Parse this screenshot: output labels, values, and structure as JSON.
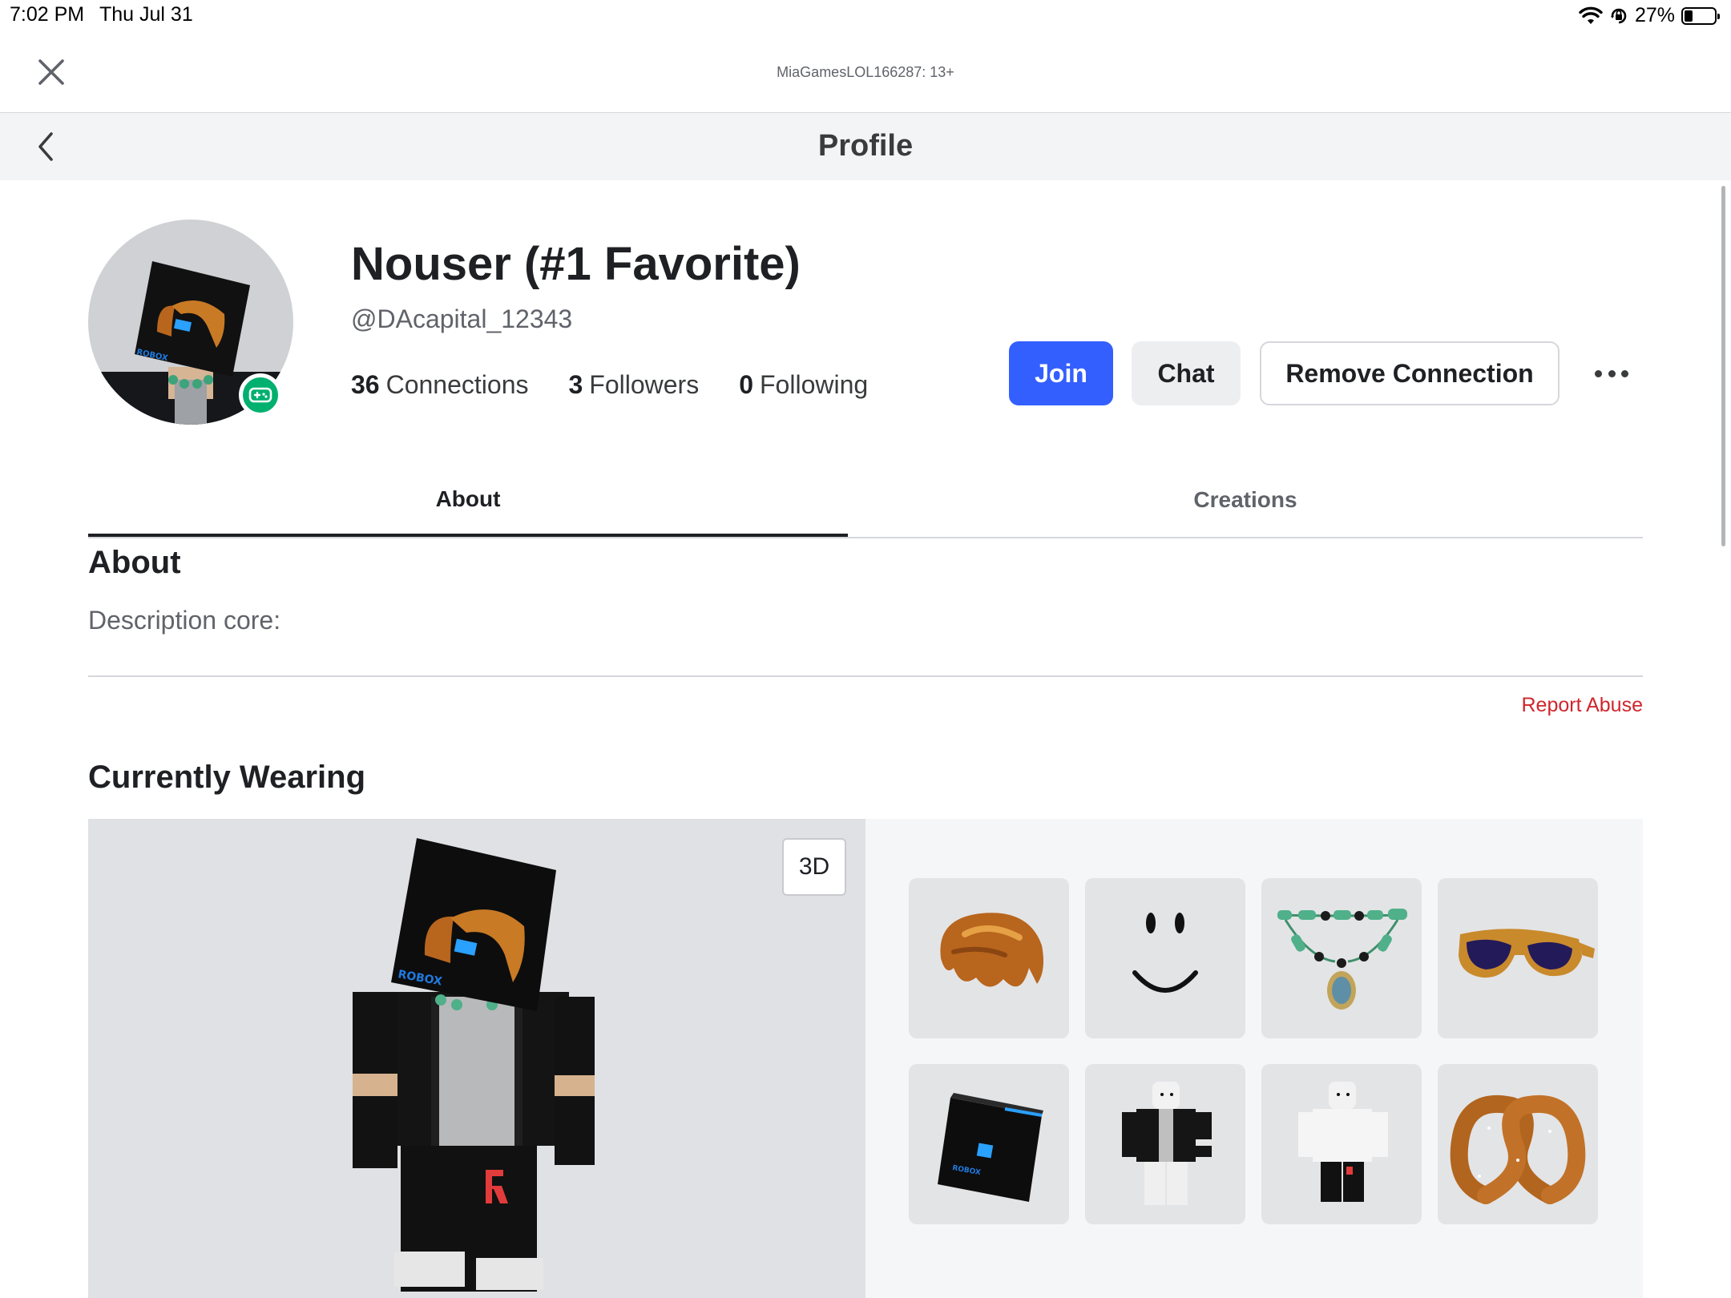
{
  "status_bar": {
    "time": "7:02 PM",
    "date": "Thu Jul 31",
    "battery": "27%",
    "battery_level": 0.27
  },
  "account": {
    "label": "MiaGamesLOL166287: 13+"
  },
  "header": {
    "title": "Profile"
  },
  "profile": {
    "display_name": "Nouser (#1 Favorite)",
    "username": "@DAcapital_12343",
    "connections": {
      "count": "36",
      "label": "Connections"
    },
    "followers": {
      "count": "3",
      "label": "Followers"
    },
    "following": {
      "count": "0",
      "label": "Following"
    },
    "presence": "in-game"
  },
  "actions": {
    "join": "Join",
    "chat": "Chat",
    "remove": "Remove Connection"
  },
  "tabs": [
    {
      "label": "About",
      "active": true
    },
    {
      "label": "Creations",
      "active": false
    }
  ],
  "about": {
    "title": "About",
    "description": "Description core:",
    "report": "Report Abuse"
  },
  "wearing": {
    "title": "Currently Wearing",
    "view_toggle": "3D",
    "items": [
      {
        "icon": "brown-hair-icon"
      },
      {
        "icon": "smile-face-icon"
      },
      {
        "icon": "jade-necklace-icon"
      },
      {
        "icon": "sunglasses-icon"
      },
      {
        "icon": "roblox-box-head-icon"
      },
      {
        "icon": "jacket-shirt-icon"
      },
      {
        "icon": "pants-icon"
      },
      {
        "icon": "pretzel-icon"
      }
    ]
  },
  "colors": {
    "join": "#335fff",
    "report": "#d0262c",
    "presence": "#00b06f"
  }
}
